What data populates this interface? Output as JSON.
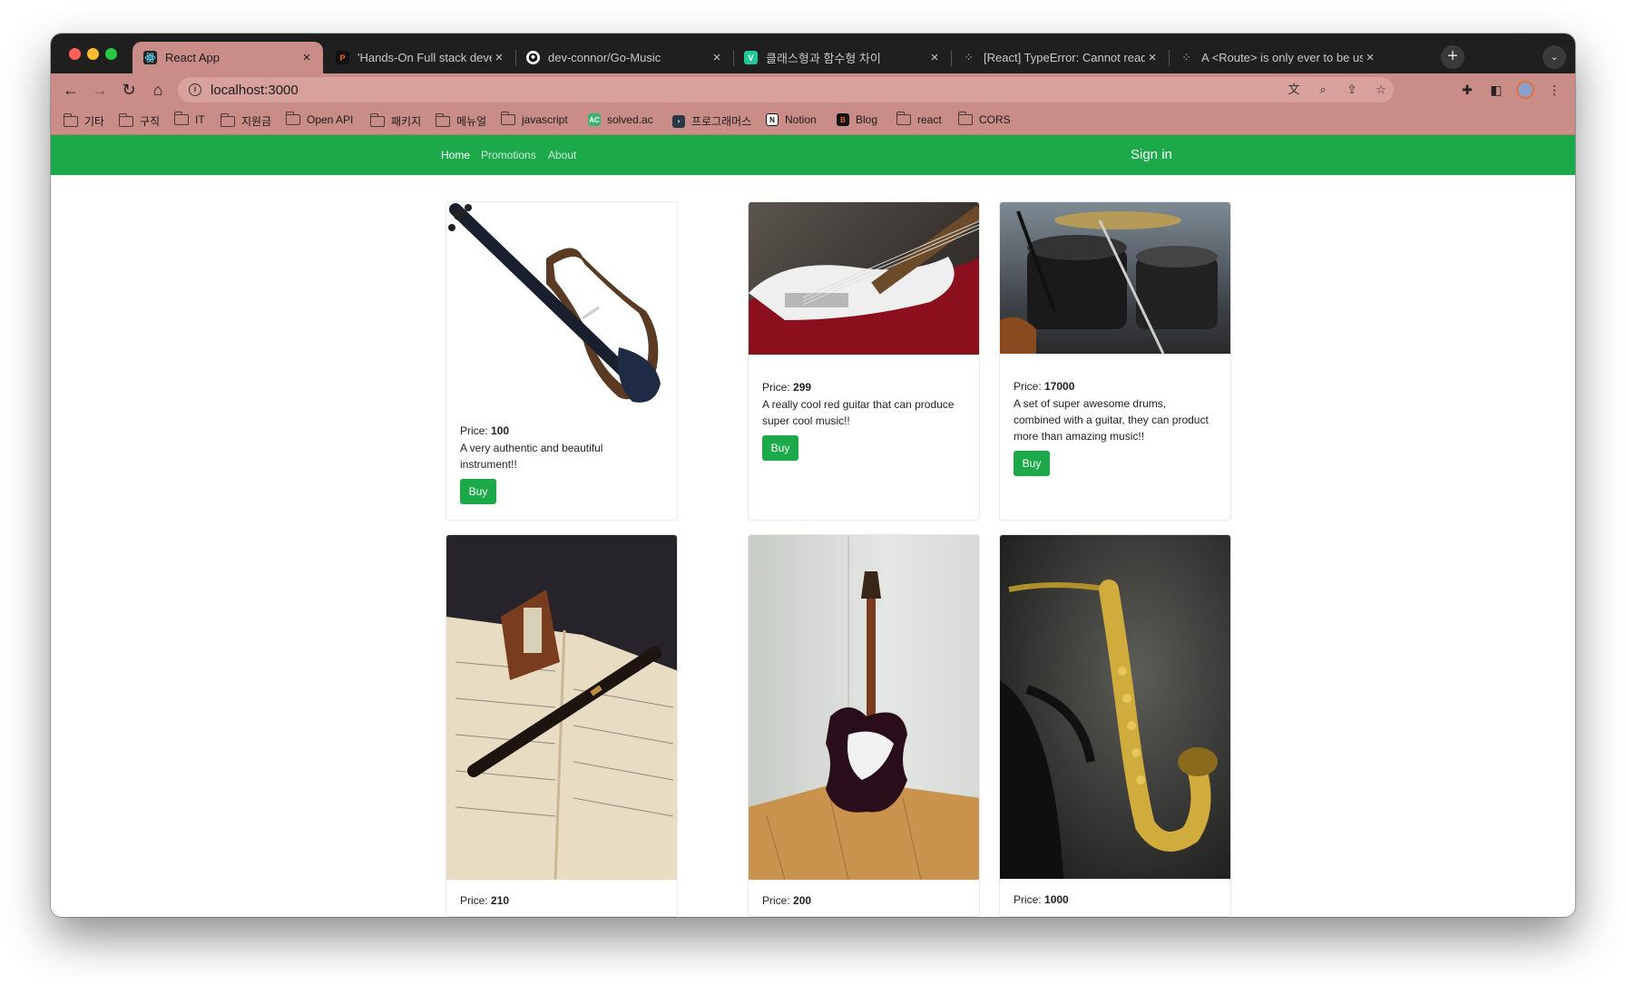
{
  "browser": {
    "tabs": [
      {
        "title": "React App",
        "favicon": "react-icon",
        "active": true
      },
      {
        "title": "'Hands-On Full stack developm",
        "favicon": "packt-icon",
        "active": false
      },
      {
        "title": "dev-connor/Go-Music",
        "favicon": "github-icon",
        "active": false
      },
      {
        "title": "클래스형과 함수형 차이",
        "favicon": "velog-icon",
        "active": false
      },
      {
        "title": "[React] TypeError: Cannot read",
        "favicon": "tistory-icon",
        "active": false
      },
      {
        "title": "A <Route> is only ever to be us",
        "favicon": "tistory-icon",
        "active": false
      }
    ],
    "close_glyph": "×",
    "new_tab_glyph": "+",
    "url": "localhost:3000",
    "bookmarks": [
      {
        "label": "기타",
        "type": "folder"
      },
      {
        "label": "구직",
        "type": "folder"
      },
      {
        "label": "IT",
        "type": "folder"
      },
      {
        "label": "지원금",
        "type": "folder"
      },
      {
        "label": "Open API",
        "type": "folder"
      },
      {
        "label": "패키지",
        "type": "folder"
      },
      {
        "label": "메뉴얼",
        "type": "folder"
      },
      {
        "label": "javascript",
        "type": "folder"
      },
      {
        "label": "solved.ac",
        "type": "site"
      },
      {
        "label": "프로그래머스",
        "type": "site"
      },
      {
        "label": "Notion",
        "type": "site"
      },
      {
        "label": "Blog",
        "type": "site"
      },
      {
        "label": "react",
        "type": "folder"
      },
      {
        "label": "CORS",
        "type": "folder"
      }
    ],
    "colors": {
      "theme": "#c98c86",
      "tabstrip": "#1f1f1f"
    }
  },
  "app": {
    "nav": {
      "home": "Home",
      "promotions": "Promotions",
      "about": "About",
      "signin": "Sign in"
    },
    "price_prefix": "Price: ",
    "buy_label": "Buy",
    "accent_color": "#1ca94a",
    "products": [
      {
        "price": "100",
        "description": "A very authentic and beautiful instrument!!",
        "image": "electric-violin"
      },
      {
        "price": "299",
        "description": "A really cool red guitar that can produce super cool music!!",
        "image": "red-guitar"
      },
      {
        "price": "17000",
        "description": "A set of super awesome drums, combined with a guitar, they can product more than amazing music!!",
        "image": "drum-set"
      },
      {
        "price": "210",
        "description": "",
        "image": "recorder-sheet-music"
      },
      {
        "price": "200",
        "description": "",
        "image": "black-electric-guitar"
      },
      {
        "price": "1000",
        "description": "",
        "image": "saxophone"
      }
    ]
  }
}
